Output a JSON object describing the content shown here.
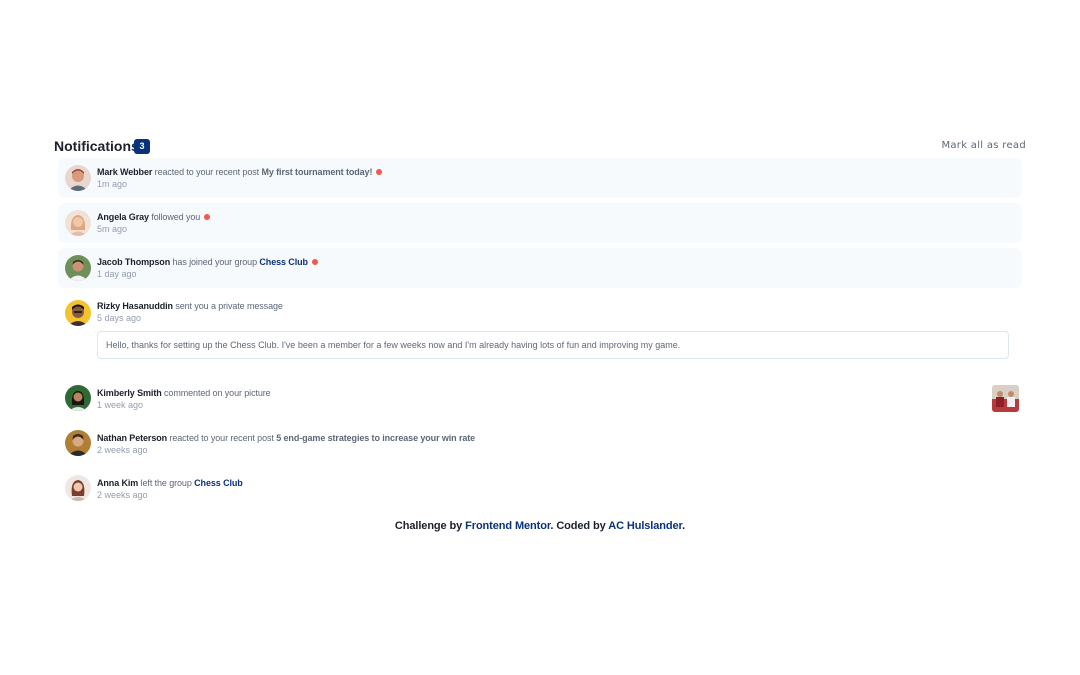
{
  "header": {
    "title": "Notifications",
    "badge_count": "3",
    "mark_all_label": "Mark all as read"
  },
  "notifications": [
    {
      "name": "Mark Webber",
      "action": "reacted to your recent post",
      "target": "My first tournament today!",
      "time": "1m ago",
      "unread": true
    },
    {
      "name": "Angela Gray",
      "action": "followed you",
      "time": "5m ago",
      "unread": true
    },
    {
      "name": "Jacob Thompson",
      "action": "has joined your group",
      "group": "Chess Club",
      "time": "1 day ago",
      "unread": true
    },
    {
      "name": "Rizky Hasanuddin",
      "action": "sent you a private message",
      "time": "5 days ago",
      "unread": false,
      "message": "Hello, thanks for setting up the Chess Club. I've been a member for a few weeks now and I'm already having lots of fun and improving my game."
    },
    {
      "name": "Kimberly Smith",
      "action": "commented on your picture",
      "time": "1 week ago",
      "unread": false
    },
    {
      "name": "Nathan Peterson",
      "action": "reacted to your recent post",
      "target": "5 end-game strategies to increase your win rate",
      "time": "2 weeks ago",
      "unread": false
    },
    {
      "name": "Anna Kim",
      "action": "left the group",
      "group": "Chess Club",
      "time": "2 weeks ago",
      "unread": false
    }
  ],
  "footer": {
    "prefix": "Challenge by",
    "link1": "Frontend Mentor",
    "middle": ". Coded by",
    "link2": "AC Hulslander",
    "suffix": "."
  },
  "colors": {
    "unread_bg": "#f7fafd",
    "badge_bg": "#0a327b",
    "dot": "#f65552",
    "name_text": "#1c202b",
    "body_text": "#5e6778",
    "time_text": "#939dae",
    "link": "#0a327b"
  }
}
